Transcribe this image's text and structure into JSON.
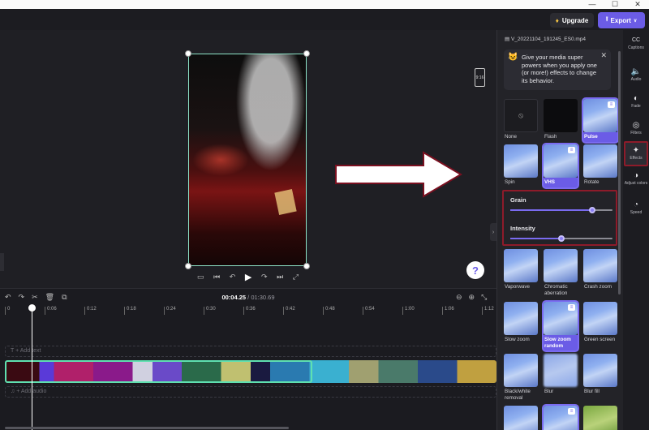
{
  "window": {
    "minimize": "—",
    "maximize": "☐",
    "close": "✕"
  },
  "header": {
    "upgrade_label": "Upgrade",
    "export_label": "Export",
    "gem_icon": "diamond-icon"
  },
  "preview": {
    "toolbar": [
      "⊡",
      "⊞",
      "↻",
      "⋯"
    ],
    "aspect_ratio": "9:16",
    "help": "?",
    "controls": {
      "captions": "▭",
      "skip_back": "⏮",
      "rewind": "↶",
      "play": "▶",
      "forward": "↷",
      "skip_forward": "⏭",
      "fullscreen": "⤢"
    }
  },
  "timeline": {
    "toolbar": [
      "↶",
      "↷",
      "✂",
      "🗑",
      "⧉"
    ],
    "current_time": "00:04.25",
    "total_time": "/ 01:30.69",
    "zoom": [
      "⊖",
      "⊕",
      "⤡"
    ],
    "ruler": [
      "0",
      "0:06",
      "0:12",
      "0:18",
      "0:24",
      "0:30",
      "0:36",
      "0:42",
      "0:48",
      "0:54",
      "1:00",
      "1:06",
      "1:12"
    ],
    "add_text": "+ Add text",
    "add_audio": "+ Add audio",
    "text_icon": "T",
    "audio_icon": "♫"
  },
  "panel": {
    "filename": "V_20221104_191245_ES0.mp4",
    "tip": "Give your media super powers when you apply one (or more!) effects to change its behavior.",
    "tip_close": "✕",
    "effects": [
      {
        "label": "None"
      },
      {
        "label": "Flash"
      },
      {
        "label": "Pulse"
      },
      {
        "label": "Spin"
      },
      {
        "label": "VHS"
      },
      {
        "label": "Rotate"
      },
      {
        "label": "Vaporwave"
      },
      {
        "label": "Chromatic aberration"
      },
      {
        "label": "Crash zoom"
      },
      {
        "label": "Slow zoom"
      },
      {
        "label": "Slow zoom random"
      },
      {
        "label": "Green screen"
      },
      {
        "label": "Black/white removal"
      },
      {
        "label": "Blur"
      },
      {
        "label": "Blur fill"
      }
    ],
    "sliders": [
      {
        "label": "Grain",
        "value": 0.8
      },
      {
        "label": "Intensity",
        "value": 0.5
      }
    ]
  },
  "rail": [
    {
      "label": "Captions",
      "icon": "CC"
    },
    {
      "label": "Audio",
      "icon": "🔈"
    },
    {
      "label": "Fade",
      "icon": "◐"
    },
    {
      "label": "Filters",
      "icon": "◎"
    },
    {
      "label": "Effects",
      "icon": "✦"
    },
    {
      "label": "Adjust colors",
      "icon": "◑"
    },
    {
      "label": "Speed",
      "icon": "◔"
    }
  ]
}
